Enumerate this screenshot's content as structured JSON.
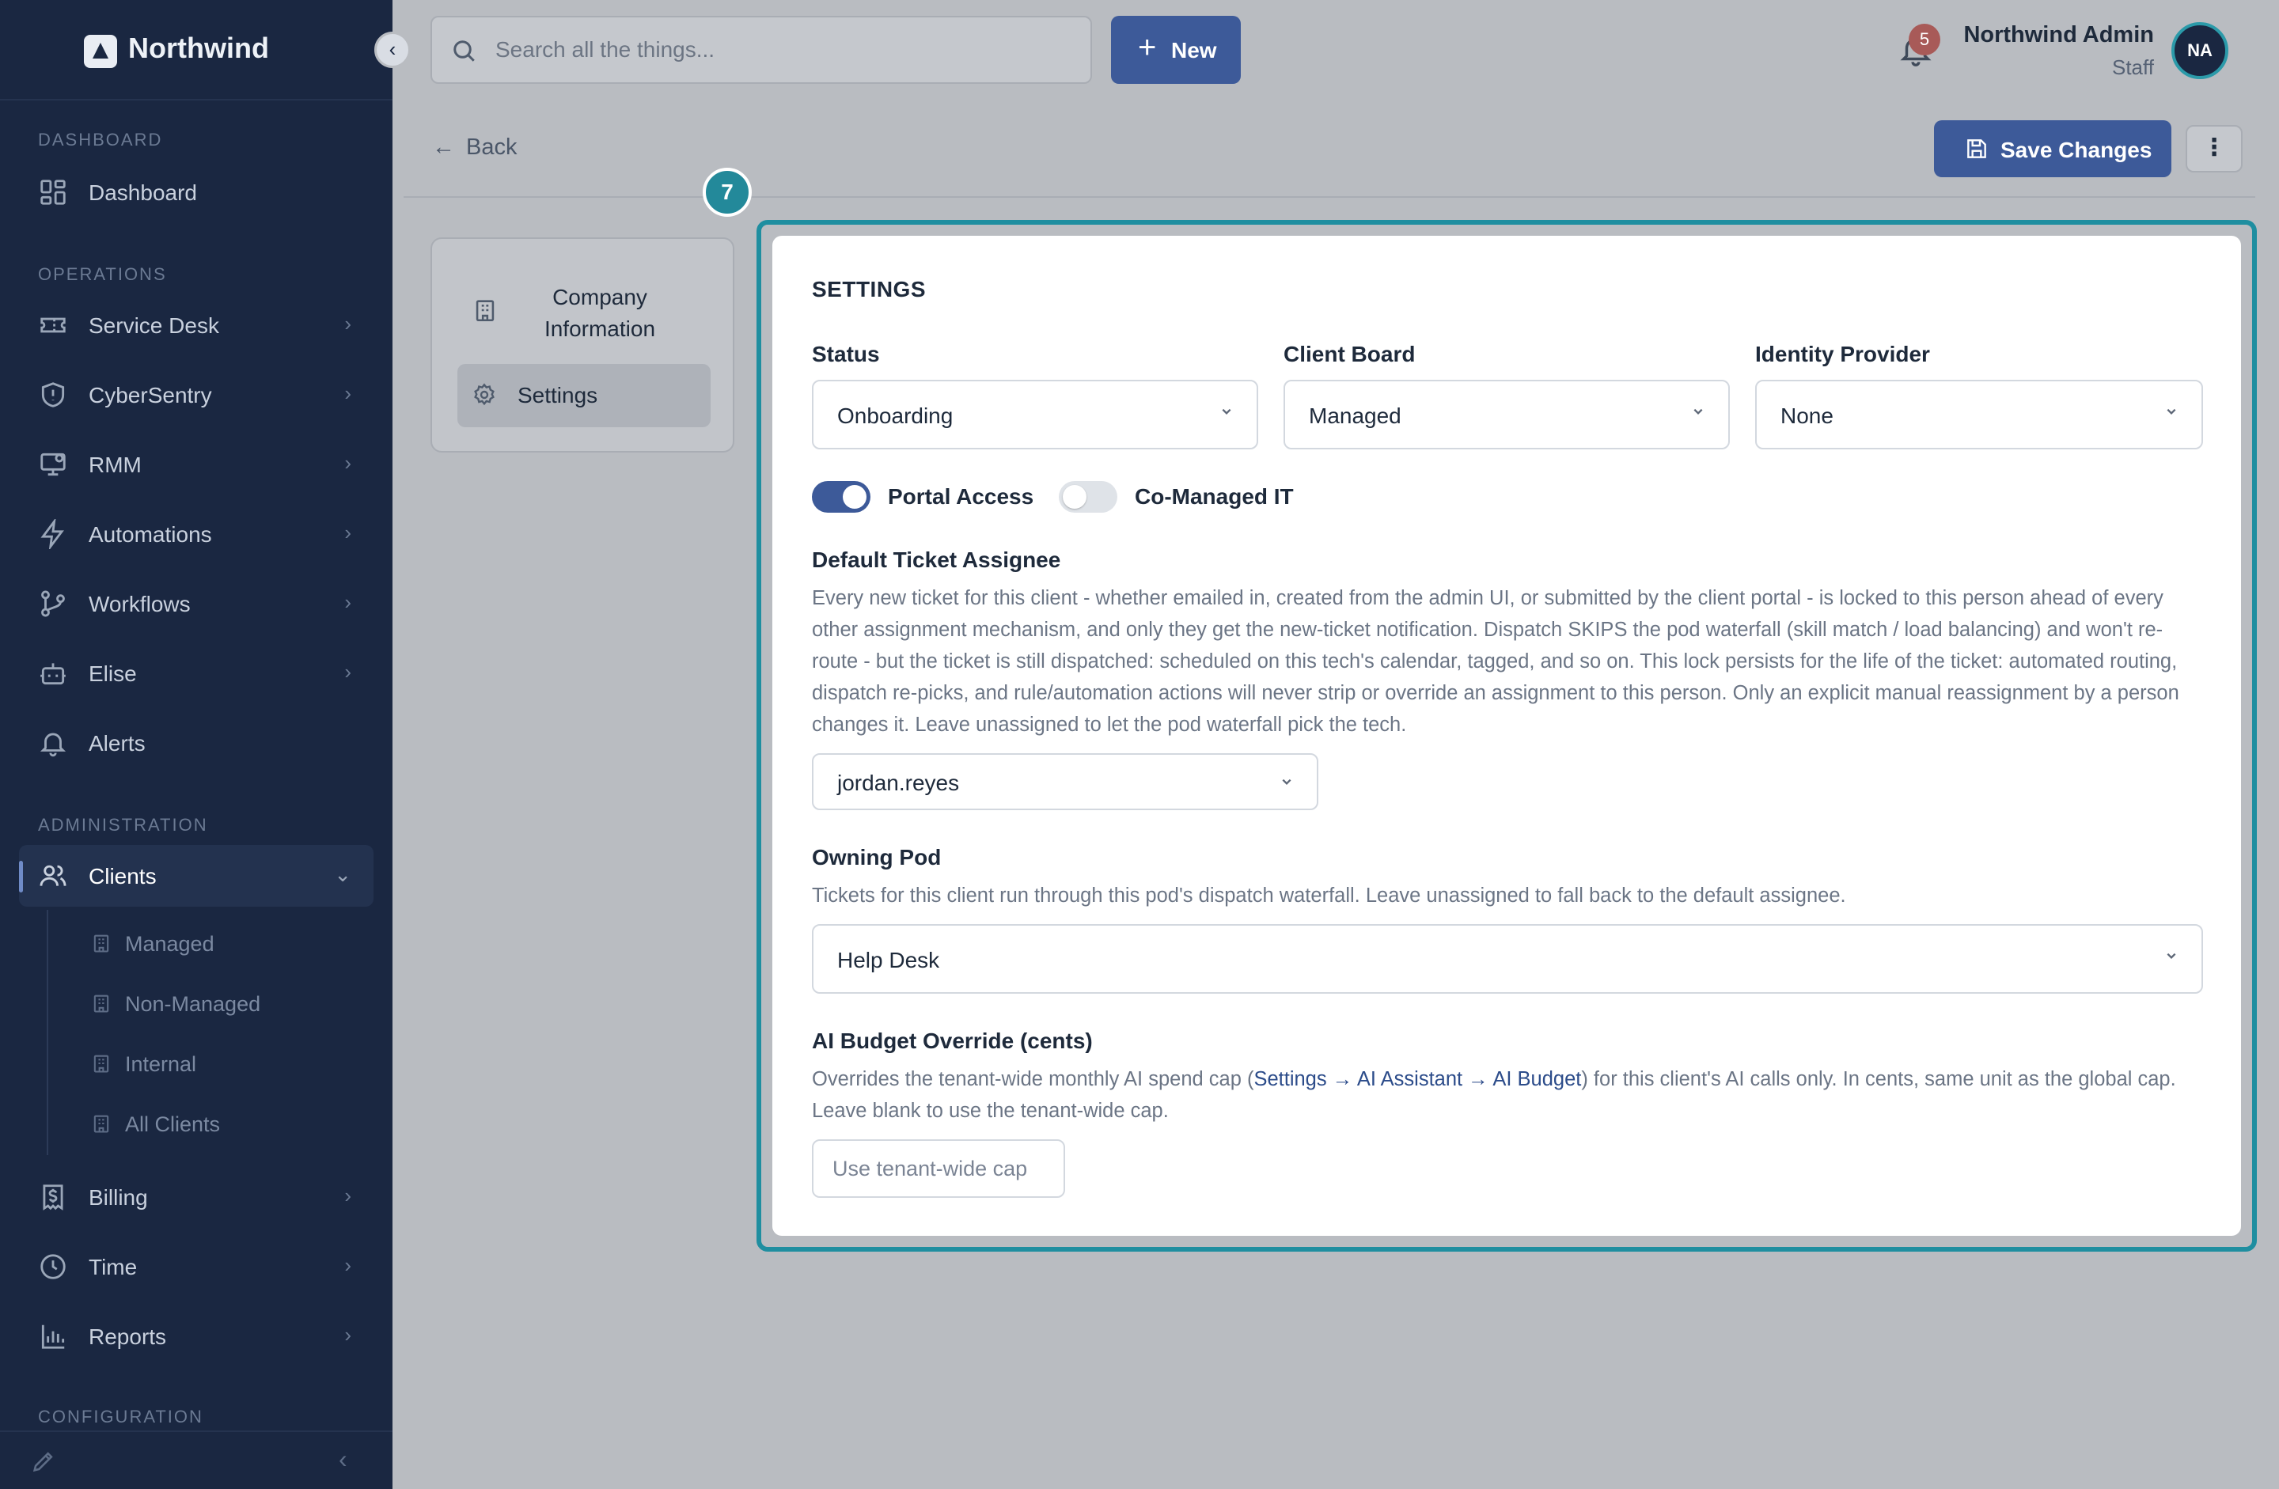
{
  "brand": {
    "name": "Northwind"
  },
  "sidebar": {
    "sections": {
      "dashboard": "DASHBOARD",
      "operations": "OPERATIONS",
      "administration": "ADMINISTRATION",
      "configuration": "CONFIGURATION"
    },
    "items": {
      "dashboard": "Dashboard",
      "service_desk": "Service Desk",
      "cybersentry": "CyberSentry",
      "rmm": "RMM",
      "automations": "Automations",
      "workflows": "Workflows",
      "elise": "Elise",
      "alerts": "Alerts",
      "clients": "Clients",
      "billing": "Billing",
      "time": "Time",
      "reports": "Reports"
    },
    "client_subitems": [
      "Managed",
      "Non-Managed",
      "Internal",
      "All Clients"
    ]
  },
  "topbar": {
    "search_placeholder": "Search all the things...",
    "new_label": "New",
    "notification_count": "5",
    "user_name": "Northwind Admin",
    "user_role": "Staff",
    "user_initials": "NA"
  },
  "page": {
    "back_label": "Back",
    "save_label": "Save Changes",
    "more_label": "⋮",
    "step_number": "7"
  },
  "tabs": {
    "company_information": [
      "Company",
      "Information"
    ],
    "settings": "Settings"
  },
  "settings": {
    "title": "SETTINGS",
    "status": {
      "label": "Status",
      "value": "Onboarding"
    },
    "client_board": {
      "label": "Client Board",
      "value": "Managed"
    },
    "identity_provider": {
      "label": "Identity Provider",
      "value": "None"
    },
    "portal_access": {
      "label": "Portal Access",
      "on": true
    },
    "co_managed_it": {
      "label": "Co-Managed IT",
      "on": false
    },
    "default_assignee": {
      "label": "Default Ticket Assignee",
      "help": "Every new ticket for this client - whether emailed in, created from the admin UI, or submitted by the client portal - is locked to this person ahead of every other assignment mechanism, and only they get the new-ticket notification. Dispatch SKIPS the pod waterfall (skill match / load balancing) and won't re-route - but the ticket is still dispatched: scheduled on this tech's calendar, tagged, and so on. This lock persists for the life of the ticket: automated routing, dispatch re-picks, and rule/automation actions will never strip or override an assignment to this person. Only an explicit manual reassignment by a person changes it. Leave unassigned to let the pod waterfall pick the tech.",
      "value": "jordan.reyes"
    },
    "owning_pod": {
      "label": "Owning Pod",
      "help": "Tickets for this client run through this pod's dispatch waterfall. Leave unassigned to fall back to the default assignee.",
      "value": "Help Desk"
    },
    "ai_budget": {
      "label": "AI Budget Override (cents)",
      "help_before": "Overrides the tenant-wide monthly AI spend cap (",
      "help_link": "Settings → AI Assistant → AI Budget",
      "help_after": ") for this client's AI calls only. In cents, same unit as the global cap. Leave blank to use the tenant-wide cap.",
      "placeholder": "Use tenant-wide cap"
    }
  },
  "colors": {
    "sidebar_bg": "#1a2741",
    "primary": "#3d5a99",
    "highlight": "#1f8ea0",
    "badge": "#a85a58"
  }
}
